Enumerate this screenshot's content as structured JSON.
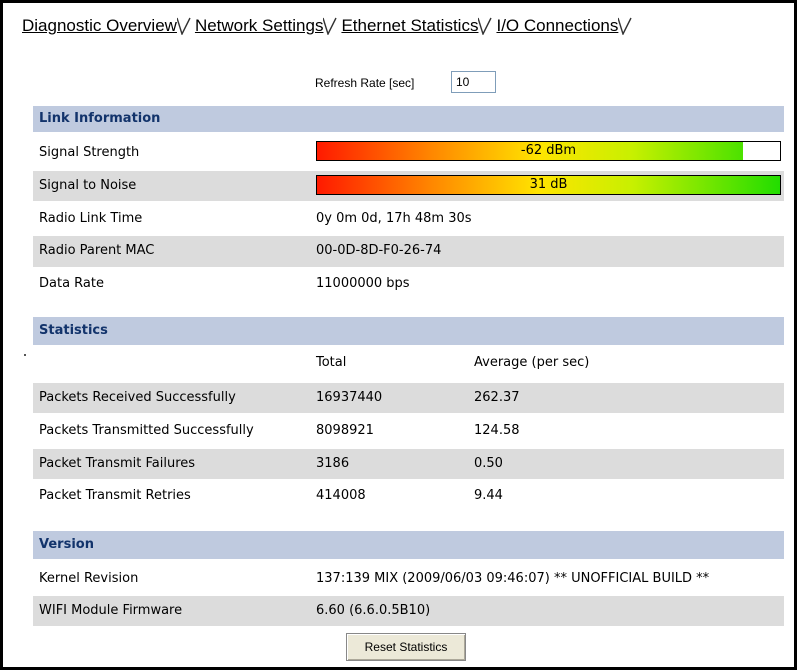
{
  "tabs": [
    {
      "label": "Diagnostic Overview"
    },
    {
      "label": "Network Settings"
    },
    {
      "label": "Ethernet Statistics"
    },
    {
      "label": "I/O Connections"
    }
  ],
  "refresh": {
    "label": "Refresh Rate [sec]",
    "value": "10"
  },
  "link": {
    "header": "Link Information",
    "signal_strength": {
      "label": "Signal Strength",
      "value": "-62 dBm",
      "level": 0.92
    },
    "signal_noise": {
      "label": "Signal to Noise",
      "value": "31 dB",
      "level": 1.0
    },
    "radio_link_time": {
      "label": "Radio Link Time",
      "value": "0y 0m 0d, 17h 48m 30s"
    },
    "radio_parent_mac": {
      "label": "Radio Parent MAC",
      "value": "00-0D-8D-F0-26-74"
    },
    "data_rate": {
      "label": "Data Rate",
      "value": "11000000 bps"
    }
  },
  "statistics": {
    "header": "Statistics",
    "col_total": "Total",
    "col_average": "Average (per sec)",
    "rows": [
      {
        "label": "Packets Received Successfully",
        "total": "16937440",
        "average": "262.37"
      },
      {
        "label": "Packets Transmitted Successfully",
        "total": "8098921",
        "average": "124.58"
      },
      {
        "label": "Packet Transmit Failures",
        "total": "3186",
        "average": "0.50"
      },
      {
        "label": "Packet Transmit Retries",
        "total": "414008",
        "average": "9.44"
      }
    ]
  },
  "version": {
    "header": "Version",
    "kernel": {
      "label": "Kernel Revision",
      "value": "137:139 MIX (2009/06/03 09:46:07) ** UNOFFICIAL BUILD **"
    },
    "wifi": {
      "label": "WIFI Module Firmware",
      "value": "6.60 (6.6.0.5B10)"
    }
  },
  "reset_label": "Reset Statistics",
  "colors": {
    "header_bg": "#bfcadf",
    "header_text": "#12336b",
    "row_shade": "#dcdcdc"
  }
}
